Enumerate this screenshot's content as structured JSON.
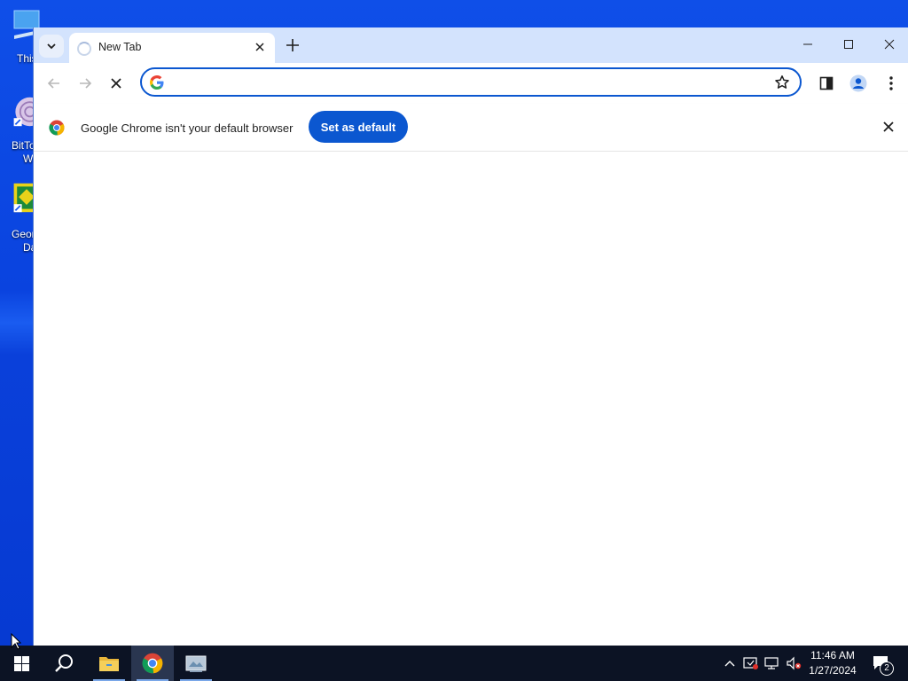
{
  "desktop": {
    "icons": [
      {
        "label": "This",
        "name": "this-pc"
      },
      {
        "label": "BitTo",
        "label2": "W",
        "name": "bittorrent"
      },
      {
        "label": "Geon",
        "label2": "Da",
        "name": "geometry-dash"
      }
    ]
  },
  "browser": {
    "tab_title": "New Tab",
    "omnibox": {
      "value": "",
      "placeholder": ""
    },
    "infobar": {
      "message": "Google Chrome isn't your default browser",
      "button_label": "Set as default"
    },
    "accent_color": "#0b57d0",
    "tabstrip_color": "#d3e3fd"
  },
  "taskbar": {
    "apps": [
      "start-icon",
      "search-icon",
      "file-explorer-icon",
      "chrome-icon",
      "app-icon"
    ],
    "clock": {
      "time": "11:46 AM",
      "date": "1/27/2024"
    },
    "notification_count": "2"
  }
}
